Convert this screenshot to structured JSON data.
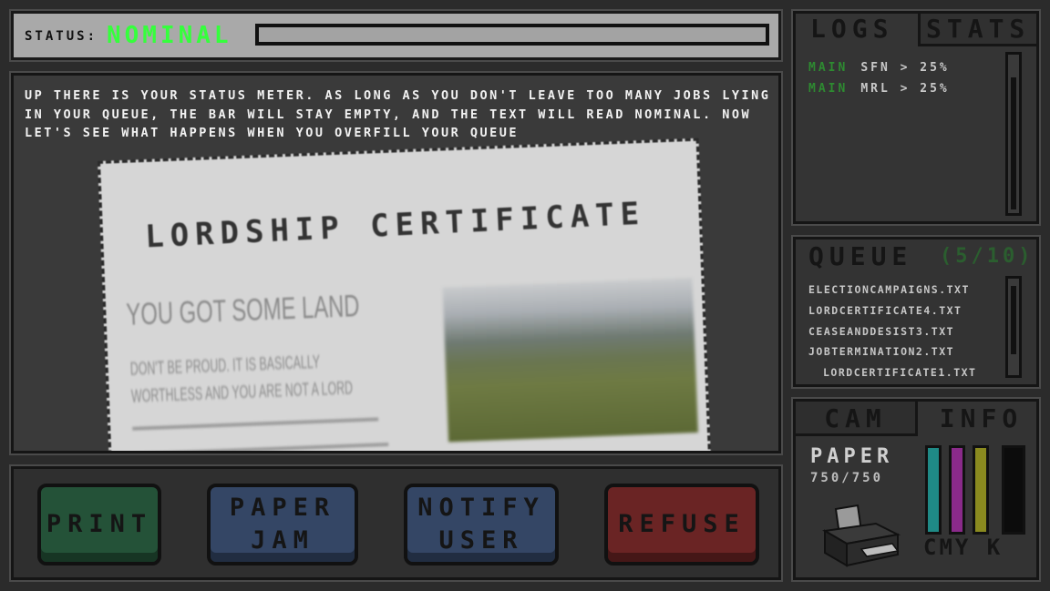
{
  "status": {
    "label": "STATUS:",
    "value": "NOMINAL",
    "value_color": "#35ff3c",
    "meter_fill_percent": 0
  },
  "main": {
    "tutorial_text": "UP THERE IS YOUR STATUS METER. AS LONG AS YOU DON'T LEAVE TOO MANY JOBS LYING IN YOUR QUEUE, THE BAR WILL STAY EMPTY, AND THE TEXT WILL READ NOMINAL. NOW LET'S SEE WHAT HAPPENS WHEN YOU OVERFILL YOUR QUEUE",
    "certificate": {
      "title": "LORDSHIP CERTIFICATE",
      "subtitle": "YOU GOT SOME LAND",
      "line1": "DON'T BE PROUD. IT IS BASICALLY",
      "line2": "WORTHLESS AND YOU ARE NOT A LORD"
    }
  },
  "buttons": {
    "print": "PRINT",
    "paper_jam_1": "PAPER",
    "paper_jam_2": "JAM",
    "notify_1": "NOTIFY",
    "notify_2": "USER",
    "refuse": "REFUSE"
  },
  "logs": {
    "tab_logs": "LOGS",
    "tab_stats": "STATS",
    "rows": [
      {
        "tag": "MAIN",
        "text": "SFN > 25%"
      },
      {
        "tag": "MAIN",
        "text": "MRL > 25%"
      }
    ]
  },
  "queue": {
    "title": "QUEUE",
    "count": "(5/10)",
    "items": [
      "ELECTIONCAMPAIGNS.TXT",
      "LORDCERTIFICATE4.TXT",
      "CEASEANDDESIST3.TXT",
      "JOBTERMINATION2.TXT",
      "LORDCERTIFICATE1.TXT"
    ]
  },
  "info": {
    "tab_cam": "CAM",
    "tab_info": "INFO",
    "paper_label": "PAPER",
    "paper_count": "750/750",
    "ink_labels": "CMY K",
    "ink_levels": {
      "cyan": 1.0,
      "magenta": 1.0,
      "yellow": 1.0,
      "black": 1.0
    },
    "ink_colors": {
      "cyan": "#1f8a86",
      "magenta": "#8a2a8a",
      "yellow": "#8a8a1f",
      "black": "#0c0c0c"
    }
  }
}
